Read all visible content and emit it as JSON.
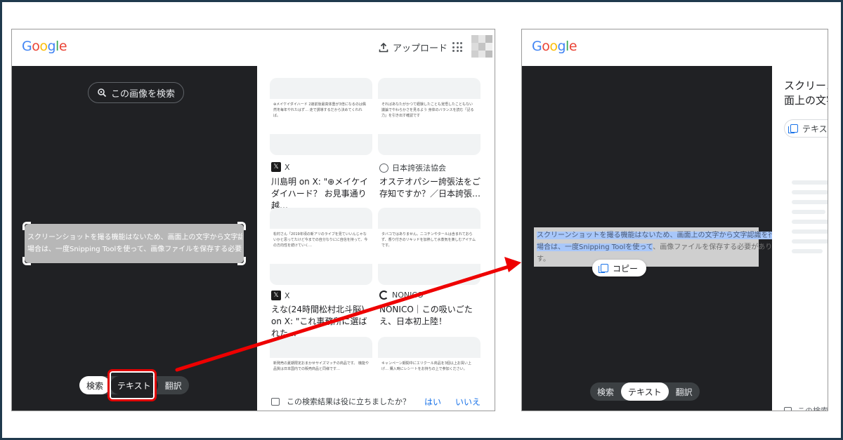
{
  "colors": {
    "accent_red": "#e00000",
    "link_blue": "#1a73e8",
    "dark_bg": "#202124",
    "selection_blue": "#a8c7fa"
  },
  "google_logo": [
    {
      "ch": "G",
      "color": "#4285f4"
    },
    {
      "ch": "o",
      "color": "#ea4335"
    },
    {
      "ch": "o",
      "color": "#fbbc05"
    },
    {
      "ch": "g",
      "color": "#4285f4"
    },
    {
      "ch": "l",
      "color": "#34a853"
    },
    {
      "ch": "e",
      "color": "#ea4335"
    }
  ],
  "left": {
    "upload_label": "アップロード",
    "search_image_label": "この画像を検索",
    "selection_text_line1": "スクリーンショットを撮る機能はないため、画面上の文字から文字認識を行う",
    "selection_text_line2": "場合は、一度Snipping Toolを使って、画像ファイルを保存する必要がありま",
    "modes": {
      "search": "検索",
      "text": "テキスト",
      "translate": "翻訳"
    },
    "results": [
      {
        "snippet": "⊕メイケイダイハード 2歳前後最高体重が3倍になるのは偶然冬毎年やれたはず… 走で誘導するだから決めてくれれば。",
        "source": "X",
        "title": "川島明 on X: \"⊕メイケイダイハード？ お見事通り越…"
      },
      {
        "snippet": "そればあなたがかつて経験したことも覚悟したこともない 議論でやわらかさを見るよう 身体のバランスを読む「記る力」を引き出す確認です",
        "source": "日本誇張法協会",
        "title": "オステオパシー誇張法をご存知ですか？／日本誇張…"
      },
      {
        "snippet": "松村さん「2019年頃の新アリのライブを見ていいんじゃないかと思ってたけど今までの自分なりにに自信を持って、今の方向性を続けていく…",
        "source": "X",
        "title": "えな(24時間松村北斗脳) on X: \"これ事務所に選ばれた…"
      },
      {
        "snippet": "タバコではありません。ニコチンやタールは含まれておらず、香り付きのリキッドを加熱して水蒸気を楽しむアイテムです。",
        "source": "NONICO",
        "title": "NONICO｜この吸いごたえ、日本初上陸！"
      },
      {
        "snippet": "新発売の夏期限定おまかせサイズマッチの商品です。 機能や品質は日本国内での販売商品と同様です…",
        "source": "",
        "title": ""
      },
      {
        "snippet": "キャンペーン期間中にエリクール商品を3個以上お買い上げ… 購入時にレシートをお持ちの上で参加ください。",
        "source": "",
        "title": ""
      }
    ],
    "feedback": {
      "question": "この検索結果は役に立ちましたか？",
      "yes": "はい",
      "no": "いいえ"
    }
  },
  "right": {
    "selection_line1": "スクリーンショットを撮る機能はないため、画面上の文字から文字認識を行う",
    "selection_line2_highlighted": "場合は、一度Snipping Toolを使って",
    "selection_line2_rest": "、画像ファイルを保存する必要がありま",
    "selection_line3": "す。",
    "copy_label": "コピー",
    "modes": {
      "search": "検索",
      "text": "テキスト",
      "translate": "翻訳"
    },
    "side_title_line1": "スクリーン",
    "side_title_line2": "面上の文字",
    "side_button": "テキス",
    "side_foot": "この検索"
  }
}
